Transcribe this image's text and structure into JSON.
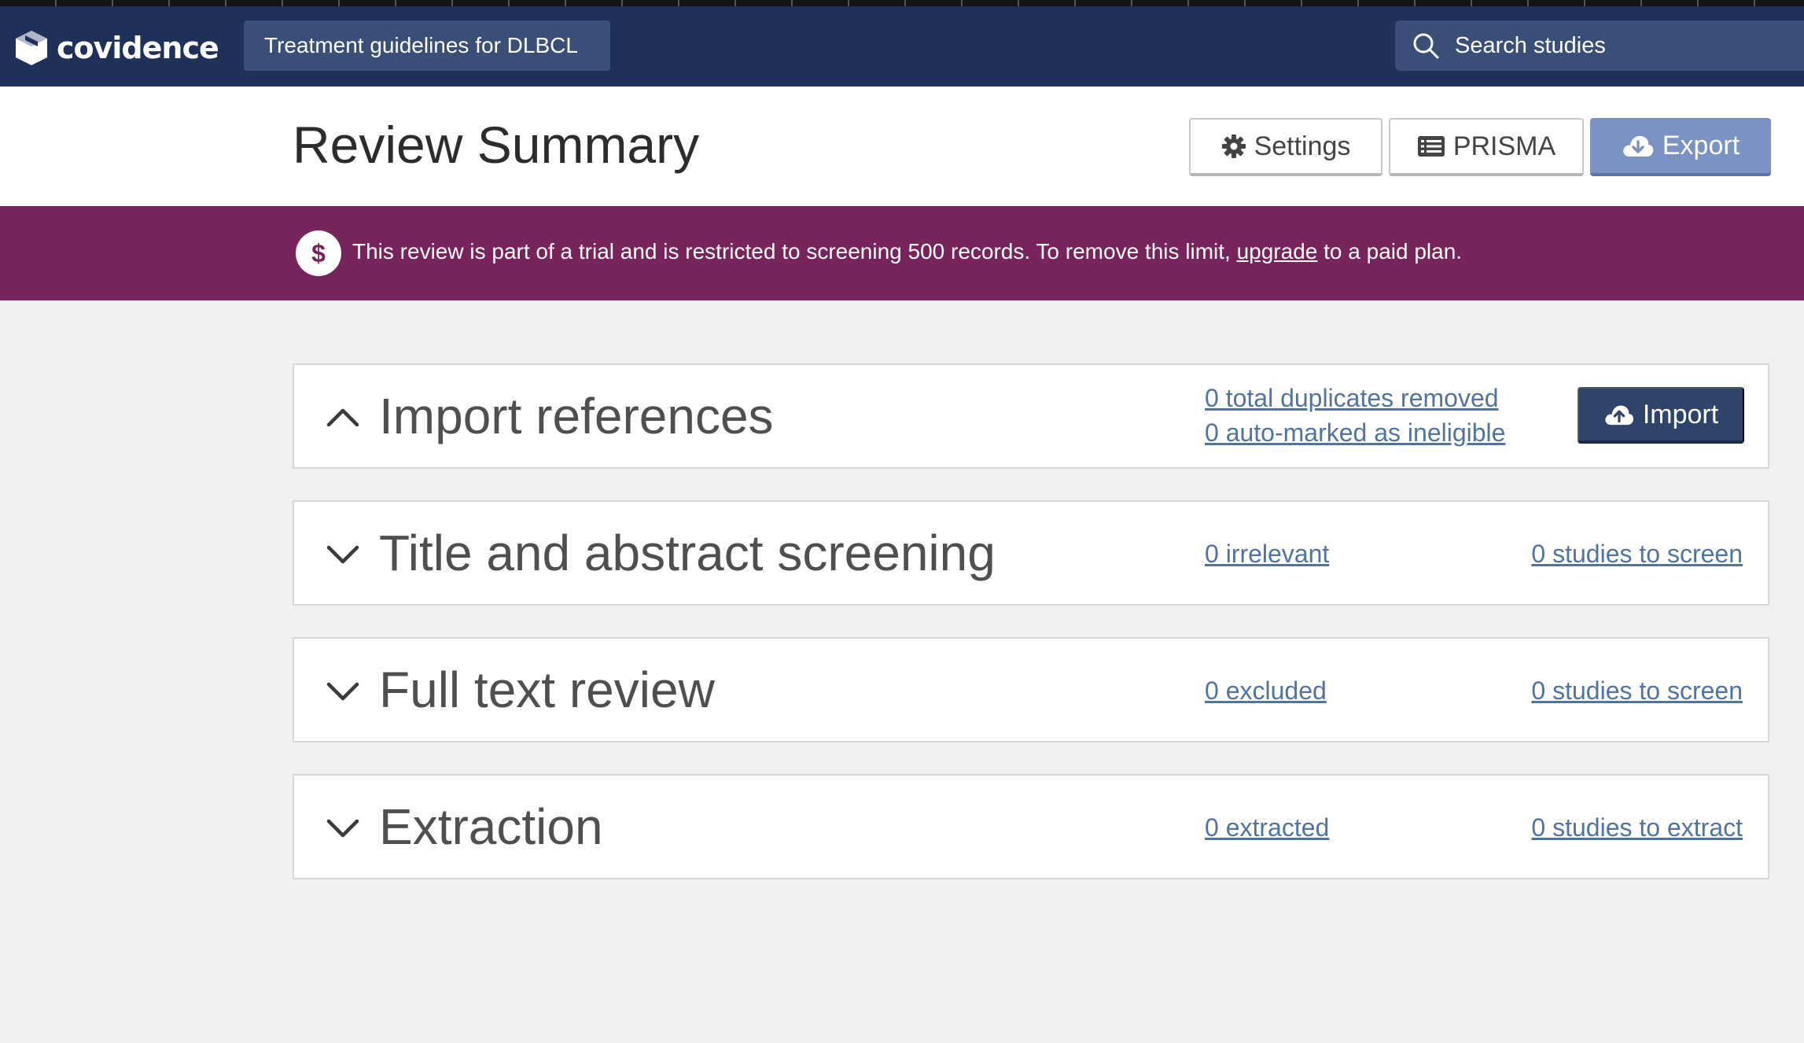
{
  "app": {
    "brand": "covidence",
    "review_name": "Treatment guidelines for DLBCL",
    "search_placeholder": "Search studies"
  },
  "header": {
    "title": "Review Summary",
    "buttons": {
      "settings": "Settings",
      "prisma": "PRISMA",
      "export": "Export"
    }
  },
  "banner": {
    "icon": "$",
    "text_before": "This review is part of a trial and is restricted to screening 500 records. To remove this limit, ",
    "link": "upgrade",
    "text_after": " to a paid plan."
  },
  "stages": [
    {
      "title": "Import references",
      "expanded": true,
      "links": [
        "0 total duplicates removed",
        "0 auto-marked as ineligible"
      ],
      "action": "Import"
    },
    {
      "title": "Title and abstract screening",
      "expanded": false,
      "left_link": "0 irrelevant",
      "right_link": "0 studies to screen"
    },
    {
      "title": "Full text review",
      "expanded": false,
      "left_link": "0 excluded",
      "right_link": "0 studies to screen"
    },
    {
      "title": "Extraction",
      "expanded": false,
      "left_link": "0 extracted",
      "right_link": "0 studies to extract"
    }
  ],
  "colors": {
    "navbar": "#1f3158",
    "banner": "#78245c",
    "link": "#4f74a0",
    "export_button": "#7b93c4",
    "import_button": "#2e446b"
  }
}
